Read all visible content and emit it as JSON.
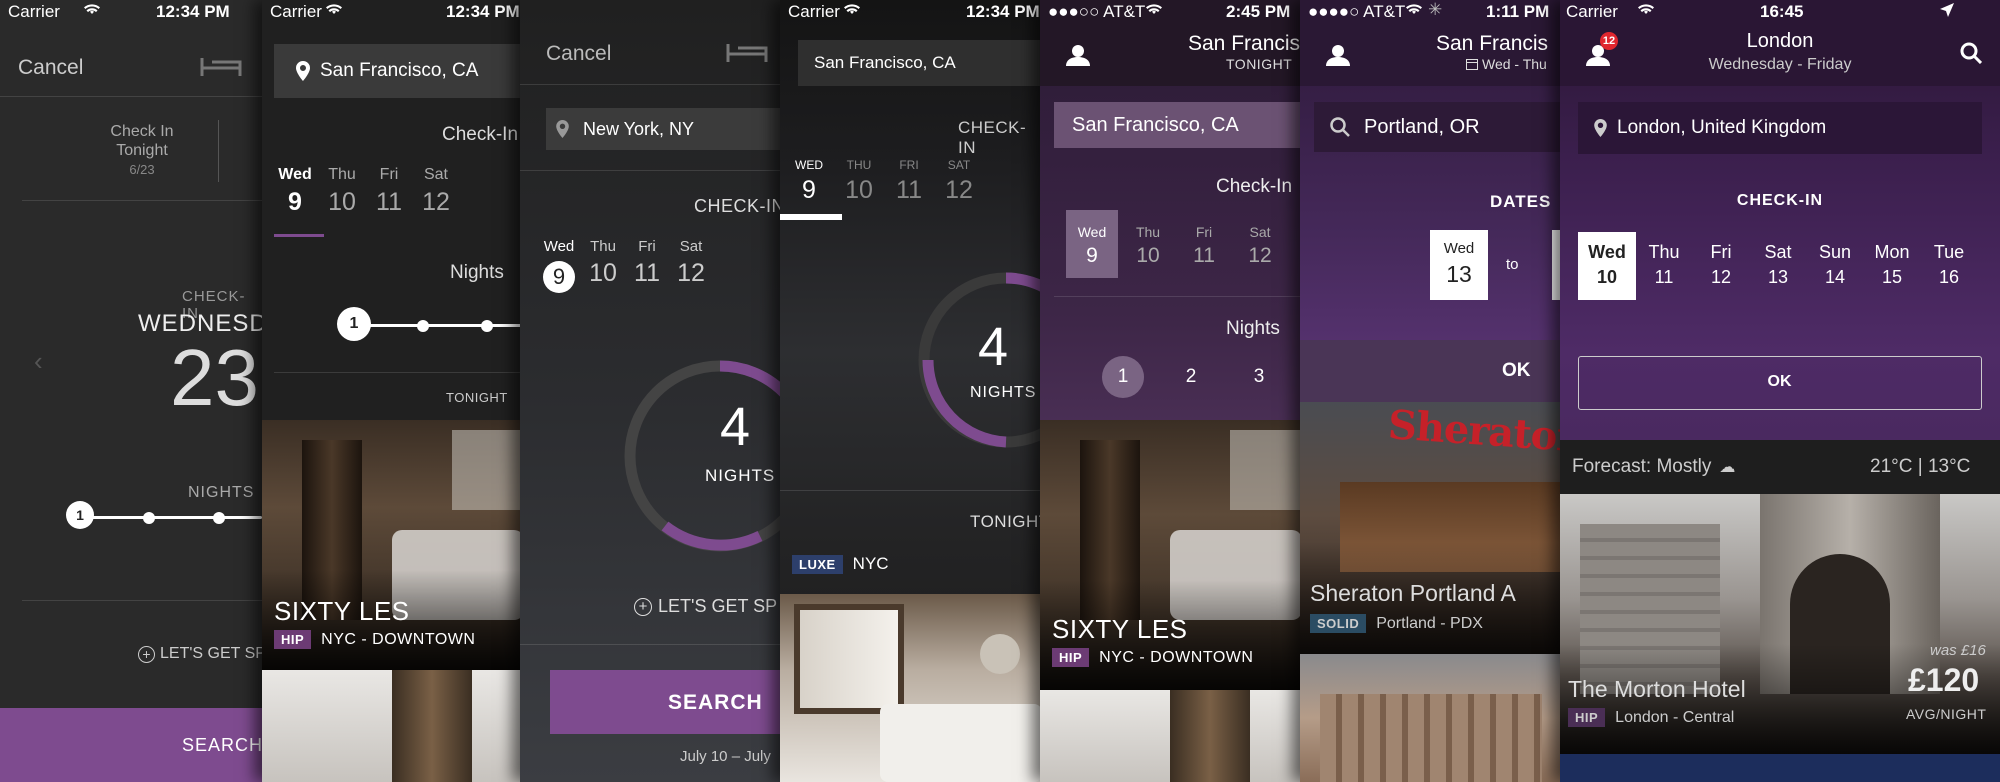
{
  "p1": {
    "carrier": "Carrier",
    "time": "12:34 PM",
    "cancel": "Cancel",
    "bed_icon": "bed-icon",
    "checkin_label": "Check In",
    "checkin_sub": "Tonight",
    "checkin_date": "6/23",
    "checkin_caps": "CHECK-IN",
    "weekday": "WEDNESD",
    "day": "23",
    "nights_label": "NIGHTS",
    "nights_knob": "1",
    "cta": "LET'S GET SPE",
    "search": "SEARCH"
  },
  "p2": {
    "carrier": "Carrier",
    "time": "12:34 PM",
    "location": "San Francisco, CA",
    "checkin": "Check-In",
    "days": [
      {
        "n": "Wed",
        "d": "9"
      },
      {
        "n": "Thu",
        "d": "10"
      },
      {
        "n": "Fri",
        "d": "11"
      },
      {
        "n": "Sat",
        "d": "12"
      }
    ],
    "nights": "Nights",
    "nights_knob": "1",
    "tonight": "TONIGHT",
    "hotel": "SIXTY LES",
    "tag": "HIP",
    "area": "NYC - DOWNTOWN"
  },
  "p3": {
    "cancel": "Cancel",
    "location": "New York, NY",
    "checkin": "CHECK-IN",
    "days": [
      {
        "n": "Wed",
        "d": "9"
      },
      {
        "n": "Thu",
        "d": "10"
      },
      {
        "n": "Fri",
        "d": "11"
      },
      {
        "n": "Sat",
        "d": "12"
      }
    ],
    "nights_count": "4",
    "nights_label": "NIGHTS",
    "cta": "LET'S GET SP",
    "search": "SEARCH",
    "dates": "July 10 – July"
  },
  "p4": {
    "carrier": "Carrier",
    "time": "12:34 PM",
    "location": "San Francisco, CA",
    "checkin": "CHECK-IN",
    "days": [
      {
        "n": "WED",
        "d": "9"
      },
      {
        "n": "THU",
        "d": "10"
      },
      {
        "n": "FRI",
        "d": "11"
      },
      {
        "n": "SAT",
        "d": "12"
      }
    ],
    "nights_count": "4",
    "nights_label": "NIGHTS",
    "tonight": "TONIGHT",
    "tag": "LUXE",
    "area": "NYC"
  },
  "p5": {
    "carrier": "●●●○○ AT&T",
    "time": "2:45 PM",
    "title": "San Francis",
    "subtitle": "TONIGHT",
    "location": "San Francisco, CA",
    "checkin": "Check-In",
    "days": [
      {
        "n": "Wed",
        "d": "9"
      },
      {
        "n": "Thu",
        "d": "10"
      },
      {
        "n": "Fri",
        "d": "11"
      },
      {
        "n": "Sat",
        "d": "12"
      }
    ],
    "nights": "Nights",
    "night_opts": [
      "1",
      "2",
      "3"
    ],
    "hotel": "SIXTY LES",
    "tag": "HIP",
    "area": "NYC - DOWNTOWN"
  },
  "p6": {
    "carrier": "●●●●○ AT&T",
    "time": "1:11 PM",
    "title": "San Francis",
    "subtitle": "Wed - Thu",
    "location": "Portland, OR",
    "dates": "DATES",
    "day_n": "Wed",
    "day_d": "13",
    "to": "to",
    "ok": "OK",
    "sign": "Sheraton",
    "hotel": "Sheraton Portland A",
    "tag": "SOLID",
    "area": "Portland - PDX"
  },
  "p7": {
    "carrier": "Carrier",
    "time": "16:45",
    "badge": "12",
    "title": "London",
    "subtitle": "Wednesday - Friday",
    "location": "London, United Kingdom",
    "checkin": "CHECK-IN",
    "days": [
      {
        "n": "Wed",
        "d": "10"
      },
      {
        "n": "Thu",
        "d": "11"
      },
      {
        "n": "Fri",
        "d": "12"
      },
      {
        "n": "Sat",
        "d": "13"
      },
      {
        "n": "Sun",
        "d": "14"
      },
      {
        "n": "Mon",
        "d": "15"
      },
      {
        "n": "Tue",
        "d": "16"
      }
    ],
    "ok": "OK",
    "forecast": "Forecast: Mostly",
    "temps": "21°C | 13°C",
    "was": "was £16",
    "hotel": "The Morton Hotel",
    "tag": "HIP",
    "area": "London - Central",
    "price": "£120",
    "per": "AVG/NIGHT"
  },
  "colors": {
    "accent": "#7e4b8f",
    "dark": "#232323",
    "purple": "#3b2448"
  }
}
